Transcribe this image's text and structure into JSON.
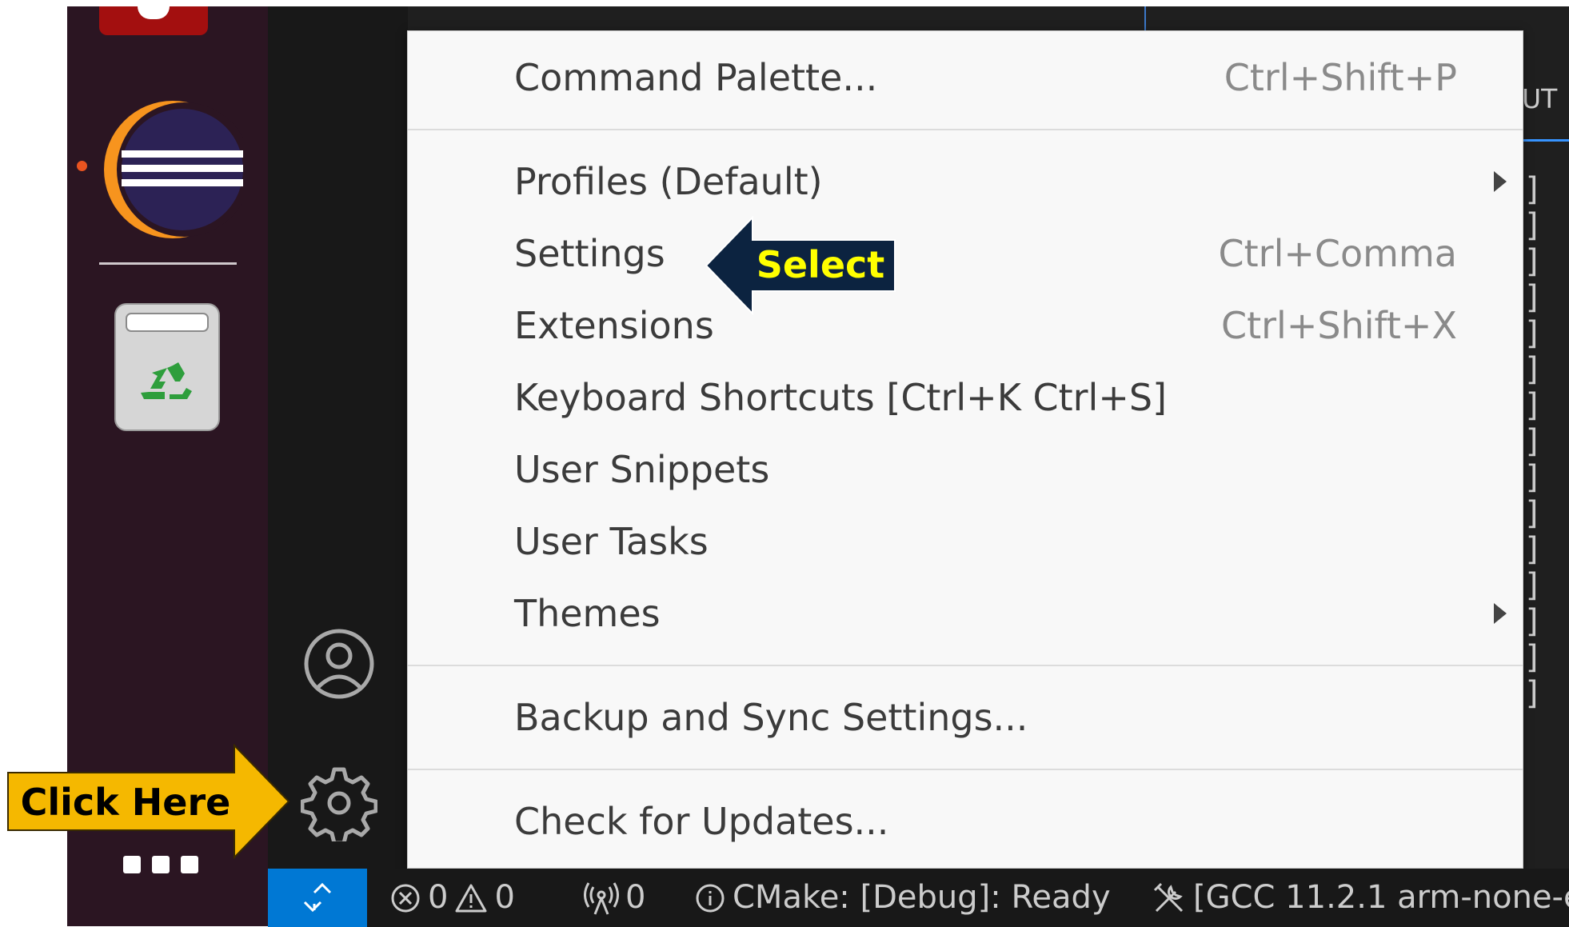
{
  "menu": {
    "items": [
      {
        "label": "Command Palette...",
        "shortcut": "Ctrl+Shift+P"
      },
      {
        "label": "Profiles (Default)",
        "shortcut": ""
      },
      {
        "label": "Settings",
        "shortcut": "Ctrl+Comma"
      },
      {
        "label": "Extensions",
        "shortcut": "Ctrl+Shift+X"
      },
      {
        "label": "Keyboard Shortcuts [Ctrl+K Ctrl+S]",
        "shortcut": ""
      },
      {
        "label": "User Snippets",
        "shortcut": ""
      },
      {
        "label": "User Tasks",
        "shortcut": ""
      },
      {
        "label": "Themes",
        "shortcut": ""
      },
      {
        "label": "Backup and Sync Settings...",
        "shortcut": ""
      },
      {
        "label": "Check for Updates...",
        "shortcut": ""
      }
    ]
  },
  "callouts": {
    "select": "Select",
    "click_here": "Click Here",
    "select_color": "#0c2340",
    "select_text_color": "#ffff00",
    "click_color": "#f5b800"
  },
  "panel": {
    "label": "UT",
    "brackets": [
      "]",
      "]",
      "]",
      "]",
      "]",
      "]",
      "]",
      "]",
      "]",
      "]",
      "]",
      "]",
      "]",
      "]",
      "]"
    ]
  },
  "status_bar": {
    "errors": "0",
    "warnings": "0",
    "ports": "0",
    "cmake": "CMake: [Debug]: Ready",
    "kit": "[GCC 11.2.1 arm-none-e"
  },
  "colors": {
    "accent": "#0078d4",
    "dock": "#2b1522",
    "activity_bar": "#181818",
    "menu_bg": "#f8f8f8"
  }
}
